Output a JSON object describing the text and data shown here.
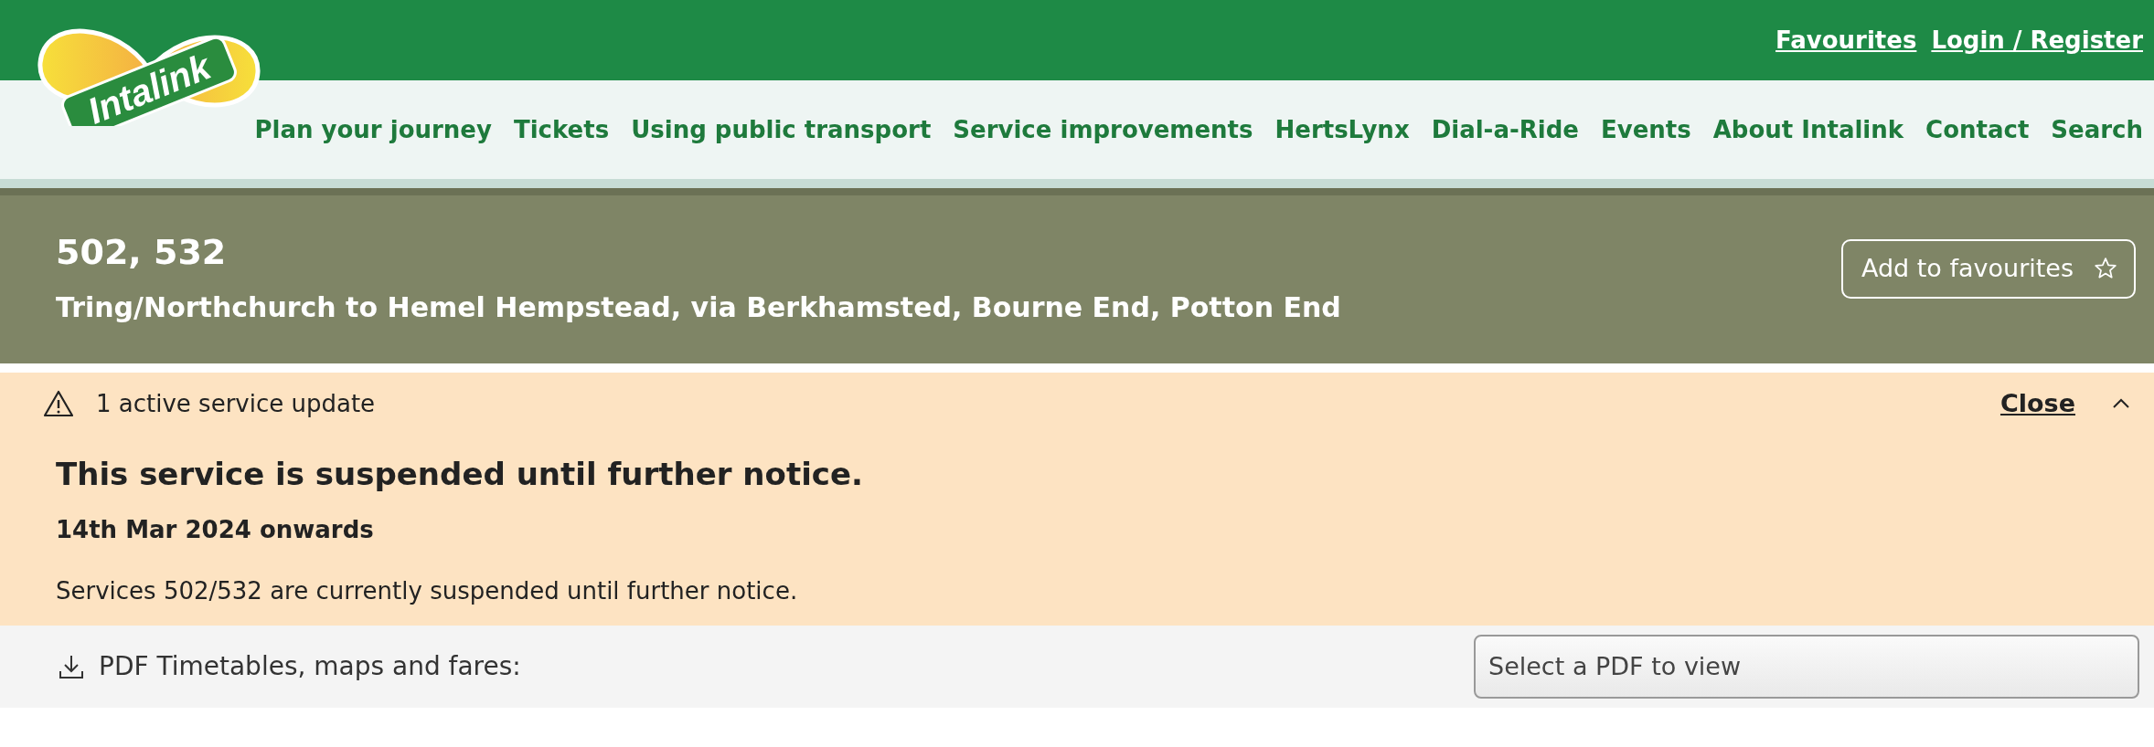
{
  "logo": {
    "text": "Intalink"
  },
  "top_links": [
    "Favourites",
    "Login / Register"
  ],
  "nav": [
    "Plan your journey",
    "Tickets",
    "Using public transport",
    "Service improvements",
    "HertsLynx",
    "Dial-a-Ride",
    "Events",
    "About Intalink",
    "Contact",
    "Search"
  ],
  "route": {
    "numbers": "502, 532",
    "description": "Tring/Northchurch to Hemel Hempstead, via Berkhamsted, Bourne End, Potton End",
    "favourite_button": "Add to favourites"
  },
  "service_update": {
    "summary": "1 active service update",
    "close": "Close",
    "expanded": true,
    "heading": "This service is suspended until further notice.",
    "date": "14th Mar 2024 onwards",
    "body": "Services 502/532 are currently suspended until further notice."
  },
  "pdf": {
    "label": "PDF Timetables, maps and fares:",
    "select": {
      "placeholder": "Select a PDF to view"
    }
  }
}
